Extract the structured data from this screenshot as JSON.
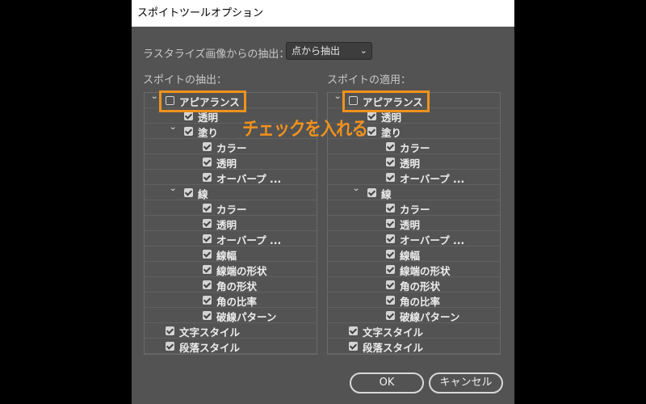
{
  "dialog": {
    "title": "スポイトツールオプション",
    "raster_label": "ラスタライズ画像からの抽出：",
    "raster_value": "点から抽出",
    "left_header": "スポイトの抽出：",
    "right_header": "スポイトの適用：",
    "ok_label": "OK",
    "cancel_label": "キャンセル"
  },
  "tree": {
    "rows": [
      {
        "label": "アピアランス",
        "level": 0,
        "expander": true,
        "checked": false
      },
      {
        "label": "透明",
        "level": 1,
        "expander": false,
        "checked": true
      },
      {
        "label": "塗り",
        "level": 1,
        "expander": true,
        "checked": true
      },
      {
        "label": "カラー",
        "level": 2,
        "expander": false,
        "checked": true
      },
      {
        "label": "透明",
        "level": 2,
        "expander": false,
        "checked": true
      },
      {
        "label": "オーバープ ...",
        "level": 2,
        "expander": false,
        "checked": true
      },
      {
        "label": "線",
        "level": 1,
        "expander": true,
        "checked": true
      },
      {
        "label": "カラー",
        "level": 2,
        "expander": false,
        "checked": true
      },
      {
        "label": "透明",
        "level": 2,
        "expander": false,
        "checked": true
      },
      {
        "label": "オーバープ ...",
        "level": 2,
        "expander": false,
        "checked": true
      },
      {
        "label": "線幅",
        "level": 2,
        "expander": false,
        "checked": true
      },
      {
        "label": "線端の形状",
        "level": 2,
        "expander": false,
        "checked": true
      },
      {
        "label": "角の形状",
        "level": 2,
        "expander": false,
        "checked": true
      },
      {
        "label": "角の比率",
        "level": 2,
        "expander": false,
        "checked": true
      },
      {
        "label": "破線パターン",
        "level": 2,
        "expander": false,
        "checked": true
      },
      {
        "label": "文字スタイル",
        "level": 0,
        "expander": false,
        "checked": true
      },
      {
        "label": "段落スタイル",
        "level": 0,
        "expander": false,
        "checked": true
      }
    ]
  },
  "annotation": {
    "text": "チェックを入れる",
    "color": "#f0921d"
  },
  "colors": {
    "dialog_bg": "#535353",
    "highlight": "#f0921d"
  }
}
